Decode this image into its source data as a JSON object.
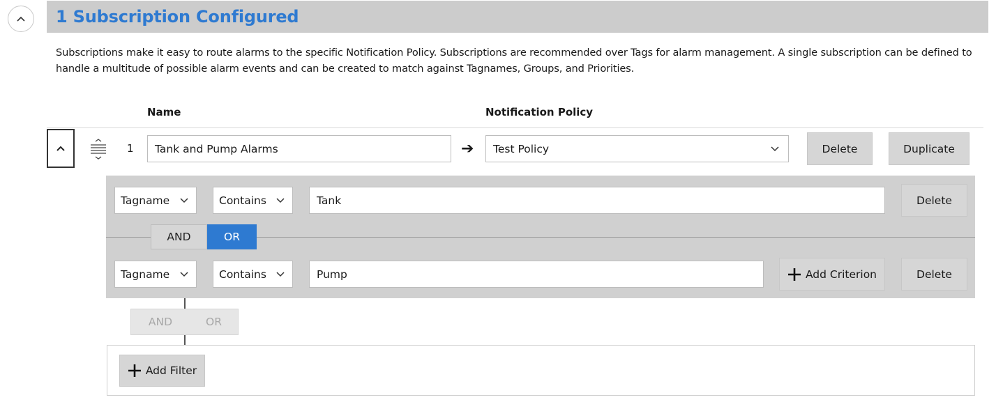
{
  "header": {
    "title": "1 Subscription Configured",
    "description": "Subscriptions make it easy to route alarms to the specific Notification Policy. Subscriptions are recommended over Tags for alarm management. A single subscription can be defined to handle a multitude of possible alarm events and can be created to match against Tagnames, Groups, and Priorities."
  },
  "columns": {
    "name": "Name",
    "policy": "Notification Policy"
  },
  "subscription": {
    "index": "1",
    "name_value": "Tank and Pump Alarms",
    "arrow": "➔",
    "policy_value": "Test Policy",
    "delete_label": "Delete",
    "duplicate_label": "Duplicate"
  },
  "criteria": [
    {
      "field": "Tagname",
      "operator": "Contains",
      "value": "Tank",
      "delete_label": "Delete"
    },
    {
      "field": "Tagname",
      "operator": "Contains",
      "value": "Pump",
      "delete_label": "Delete",
      "add_label": "Add Criterion"
    }
  ],
  "criteria_join": {
    "and": "AND",
    "or": "OR",
    "selected": "OR"
  },
  "filter_join": {
    "and": "AND",
    "or": "OR",
    "enabled": false
  },
  "add_filter_label": "Add Filter",
  "colors": {
    "accent": "#2e7ad1",
    "header_bar": "#cccccc",
    "panel": "#d0d0d0",
    "button": "#d6d6d6"
  }
}
